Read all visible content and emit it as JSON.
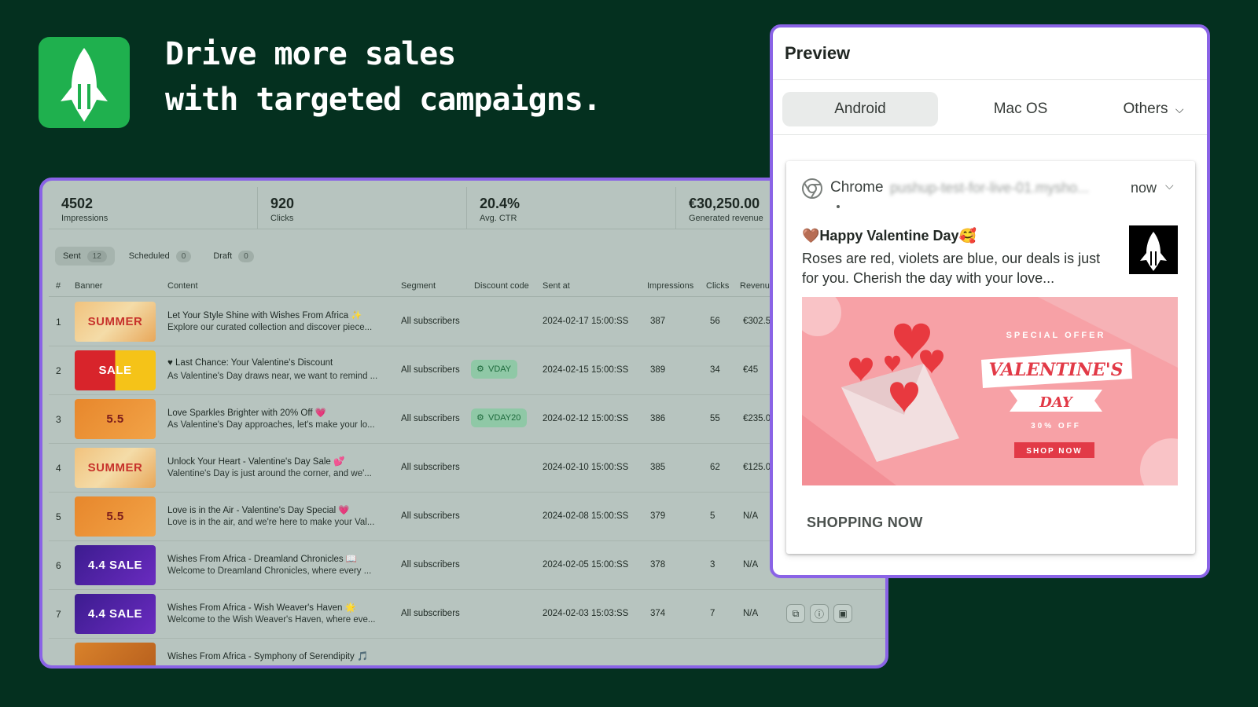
{
  "hero": {
    "headline_line1": "Drive more sales",
    "headline_line2": "with targeted campaigns."
  },
  "stats": [
    {
      "value": "4502",
      "label": "Impressions"
    },
    {
      "value": "920",
      "label": "Clicks"
    },
    {
      "value": "20.4%",
      "label": "Avg. CTR"
    },
    {
      "value": "€30,250.00",
      "label": "Generated revenue"
    }
  ],
  "tabs": [
    {
      "label": "Sent",
      "count": "12"
    },
    {
      "label": "Scheduled",
      "count": "0"
    },
    {
      "label": "Draft",
      "count": "0"
    }
  ],
  "columns": {
    "num": "#",
    "banner": "Banner",
    "content": "Content",
    "segment": "Segment",
    "discount": "Discount code",
    "sent_at": "Sent at",
    "impressions": "Impressions",
    "clicks": "Clicks",
    "revenue": "Revenue"
  },
  "rows": [
    {
      "num": "1",
      "banner": "SUMMER",
      "title": "Let Your Style Shine with Wishes From Africa ✨",
      "desc": "Explore our curated collection and discover piece...",
      "segment": "All subscribers",
      "discount": "",
      "sent_at": "2024-02-17 15:00:SS",
      "impressions": "387",
      "clicks": "56",
      "revenue": "€302.5"
    },
    {
      "num": "2",
      "banner": "SALE",
      "title": "♥ Last Chance: Your Valentine's Discount",
      "desc": "As Valentine's Day draws near, we want to remind ...",
      "segment": "All subscribers",
      "discount": "VDAY",
      "sent_at": "2024-02-15 15:00:SS",
      "impressions": "389",
      "clicks": "34",
      "revenue": "€45"
    },
    {
      "num": "3",
      "banner": "5.5",
      "title": "Love Sparkles Brighter with 20% Off 💗",
      "desc": "As Valentine's Day approaches, let's make your lo...",
      "segment": "All subscribers",
      "discount": "VDAY20",
      "sent_at": "2024-02-12 15:00:SS",
      "impressions": "386",
      "clicks": "55",
      "revenue": "€235.0"
    },
    {
      "num": "4",
      "banner": "SUMMER",
      "title": "Unlock Your Heart - Valentine's Day Sale 💕",
      "desc": "Valentine's Day is just around the corner, and we'...",
      "segment": "All subscribers",
      "discount": "",
      "sent_at": "2024-02-10 15:00:SS",
      "impressions": "385",
      "clicks": "62",
      "revenue": "€125.0"
    },
    {
      "num": "5",
      "banner": "5.5",
      "title": "Love is in the Air - Valentine's Day Special 💗",
      "desc": "Love is in the air, and we're here to make your Val...",
      "segment": "All subscribers",
      "discount": "",
      "sent_at": "2024-02-08 15:00:SS",
      "impressions": "379",
      "clicks": "5",
      "revenue": "N/A"
    },
    {
      "num": "6",
      "banner": "4.4 SALE",
      "title": "Wishes From Africa - Dreamland Chronicles 📖",
      "desc": "Welcome to Dreamland Chronicles, where every ...",
      "segment": "All subscribers",
      "discount": "",
      "sent_at": "2024-02-05 15:00:SS",
      "impressions": "378",
      "clicks": "3",
      "revenue": "N/A"
    },
    {
      "num": "7",
      "banner": "4.4 SALE",
      "title": "Wishes From Africa - Wish Weaver's Haven 🌟",
      "desc": "Welcome to the Wish Weaver's Haven, where eve...",
      "segment": "All subscribers",
      "discount": "",
      "sent_at": "2024-02-03 15:03:SS",
      "impressions": "374",
      "clicks": "7",
      "revenue": "N/A"
    },
    {
      "num": "",
      "banner": "",
      "title": "Wishes From Africa - Symphony of Serendipity 🎵",
      "desc": "",
      "segment": "",
      "discount": "",
      "sent_at": "",
      "impressions": "",
      "clicks": "",
      "revenue": ""
    }
  ],
  "preview": {
    "title": "Preview",
    "os_tabs": [
      "Android",
      "Mac OS",
      "Others"
    ],
    "notification": {
      "app": "Chrome",
      "url": "pushup-test-for-live-01.mysho...",
      "time": "now",
      "title": "🤎Happy Valentine Day🥰",
      "body": "Roses are red, violets are blue, our deals is just for you. Cherish the day with your love...",
      "image_text": {
        "special_offer": "SPECIAL OFFER",
        "valentines": "VALENTINE'S",
        "day": "DAY",
        "discount": "30% OFF",
        "shop_now": "SHOP NOW"
      },
      "action": "SHOPPING NOW"
    }
  },
  "colors": {
    "background": "#04301f",
    "brand_green": "#1fb04e",
    "accent_border": "#8a63e6",
    "valentine_pink": "#f7a1a6"
  }
}
